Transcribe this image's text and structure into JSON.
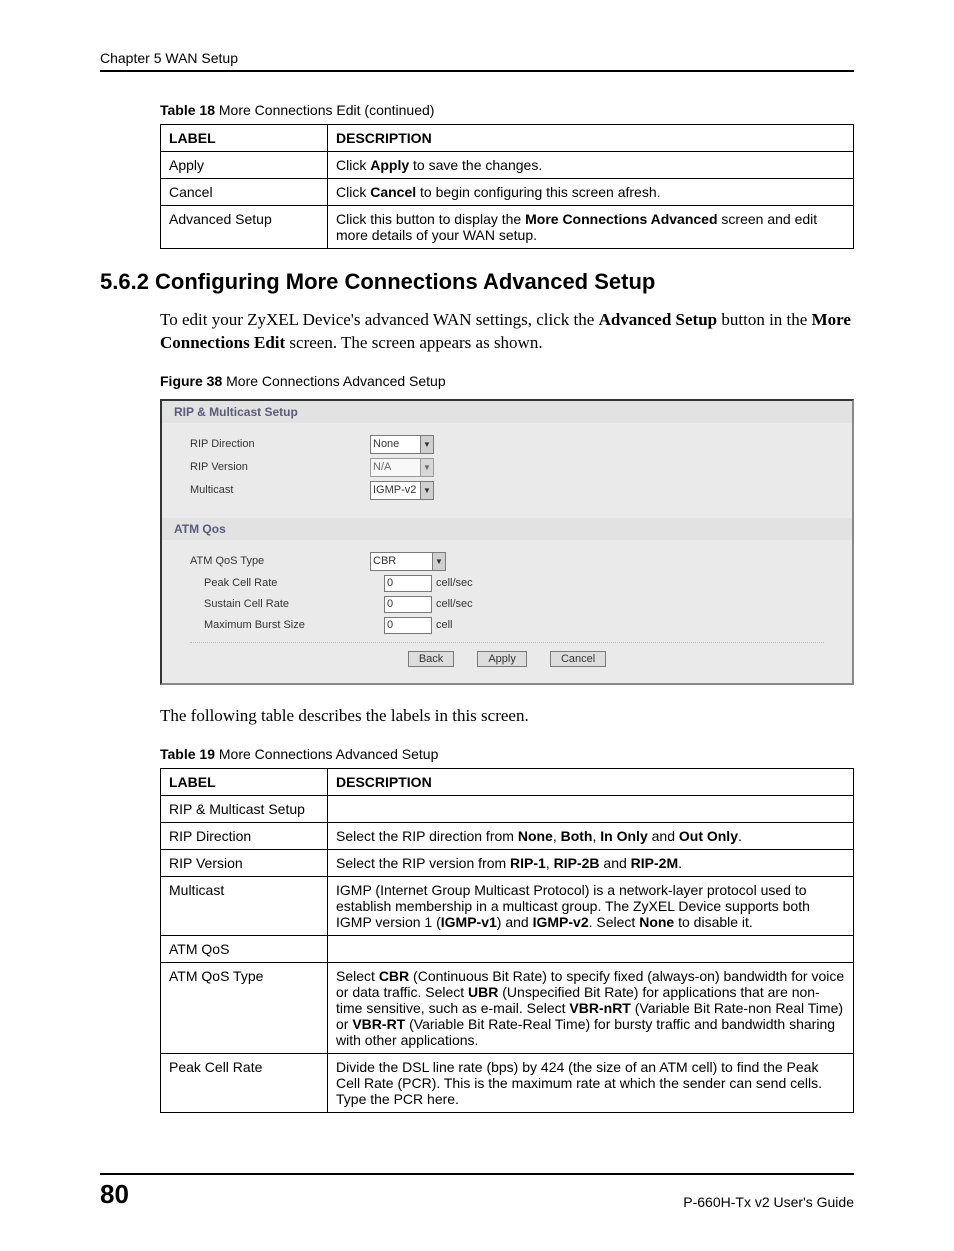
{
  "header": {
    "chapter": "Chapter 5 WAN Setup"
  },
  "table18": {
    "caption_bold": "Table 18",
    "caption_rest": "   More Connections Edit (continued)",
    "head_label": "LABEL",
    "head_desc": "DESCRIPTION",
    "rows": [
      {
        "label": "Apply",
        "d1": "Click ",
        "b1": "Apply",
        "d2": " to save the changes."
      },
      {
        "label": "Cancel",
        "d1": "Click ",
        "b1": "Cancel",
        "d2": " to begin configuring this screen afresh."
      },
      {
        "label": "Advanced Setup",
        "d1": "Click this button to display the ",
        "b1": "More Connections Advanced",
        "d2": " screen and edit more details of your WAN setup."
      }
    ]
  },
  "section": {
    "heading": "5.6.2  Configuring More Connections Advanced Setup",
    "intro_1": "To edit your ZyXEL Device's advanced WAN settings, click the ",
    "intro_b1": "Advanced Setup",
    "intro_2": " button in the ",
    "intro_b2": "More Connections Edit",
    "intro_3": " screen. The screen appears as shown.",
    "fig_caption_bold": "Figure 38",
    "fig_caption_rest": "   More Connections Advanced Setup"
  },
  "figure": {
    "bar1": "RIP & Multicast Setup",
    "rip_direction": {
      "label": "RIP Direction",
      "value": "None"
    },
    "rip_version": {
      "label": "RIP Version",
      "value": "N/A"
    },
    "multicast": {
      "label": "Multicast",
      "value": "IGMP-v2"
    },
    "bar2": "ATM Qos",
    "atm_qos_type": {
      "label": "ATM QoS Type",
      "value": "CBR"
    },
    "pcr": {
      "label": "Peak Cell Rate",
      "value": "0",
      "unit": "cell/sec"
    },
    "scr": {
      "label": "Sustain Cell Rate",
      "value": "0",
      "unit": "cell/sec"
    },
    "mbs": {
      "label": "Maximum Burst Size",
      "value": "0",
      "unit": "cell"
    },
    "btn_back": "Back",
    "btn_apply": "Apply",
    "btn_cancel": "Cancel"
  },
  "after_figure": "The following table describes the labels in this screen.",
  "table19": {
    "caption_bold": "Table 19",
    "caption_rest": "   More Connections Advanced Setup",
    "head_label": "LABEL",
    "head_desc": "DESCRIPTION",
    "rows": {
      "r0": {
        "label": "RIP & Multicast Setup",
        "desc": ""
      },
      "r1": {
        "label": "RIP Direction",
        "pre": "Select the RIP direction from ",
        "b1": "None",
        "s1": ", ",
        "b2": "Both",
        "s2": ", ",
        "b3": "In Only",
        "s3": " and ",
        "b4": "Out Only",
        "post": "."
      },
      "r2": {
        "label": "RIP Version",
        "pre": "Select the RIP version from ",
        "b1": "RIP-1",
        "s1": ", ",
        "b2": "RIP-2B",
        "s2": " and ",
        "b3": "RIP-2M",
        "post": "."
      },
      "r3": {
        "label": "Multicast",
        "pre": "IGMP (Internet Group Multicast Protocol) is a network-layer protocol used to establish membership in a multicast group. The ZyXEL Device supports both IGMP version 1 (",
        "b1": "IGMP-v1",
        "s1": ") and ",
        "b2": "IGMP-v2",
        "s2": ". Select ",
        "b3": "None",
        "post": " to disable it."
      },
      "r4": {
        "label": "ATM QoS",
        "desc": ""
      },
      "r5": {
        "label": "ATM QoS Type",
        "pre": "Select ",
        "b1": "CBR",
        "s1": " (Continuous Bit Rate) to specify fixed (always-on) bandwidth for voice or data traffic. Select ",
        "b2": "UBR",
        "s2": " (Unspecified Bit Rate) for applications that are non-time sensitive, such as e-mail. Select ",
        "b3": "VBR-nRT",
        "s3": " (Variable Bit Rate-non Real Time) or ",
        "b4": "VBR-RT",
        "post": " (Variable Bit Rate-Real Time) for bursty traffic and bandwidth sharing with other applications."
      },
      "r6": {
        "label": "Peak Cell Rate",
        "desc": "Divide the DSL line rate (bps) by 424 (the size of an ATM cell) to find the Peak Cell Rate (PCR). This is the maximum rate at which the sender can send cells. Type the PCR here."
      }
    }
  },
  "footer": {
    "page": "80",
    "guide": "P-660H-Tx v2 User's Guide"
  },
  "icons": {
    "dropdown": "▼"
  }
}
